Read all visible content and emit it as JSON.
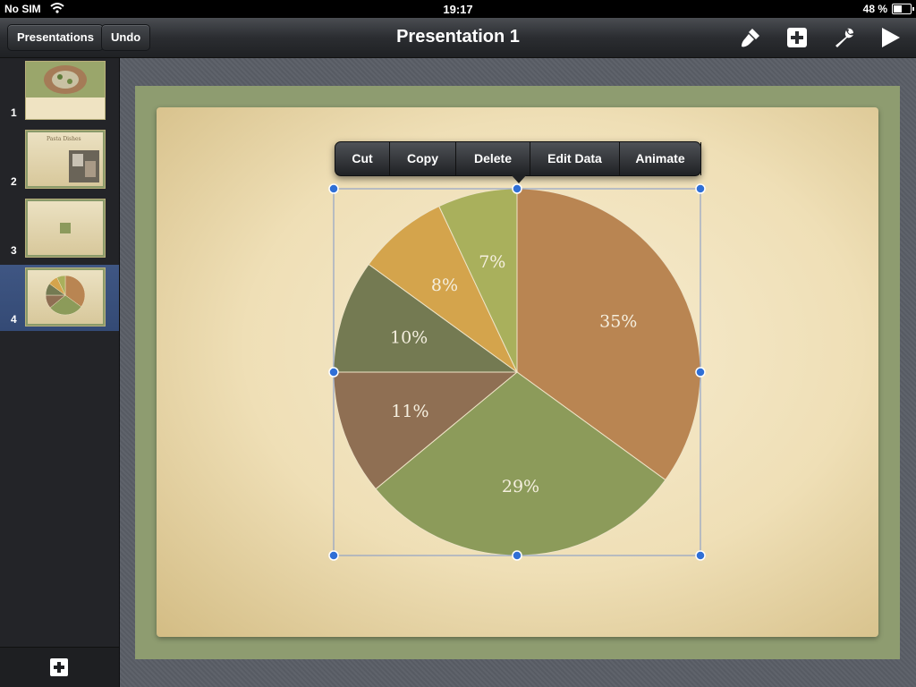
{
  "status": {
    "carrier": "No SIM",
    "time": "19:17",
    "battery": "48 %",
    "battery_level": 0.48
  },
  "toolbar": {
    "presentations_label": "Presentations",
    "undo_label": "Undo",
    "title": "Presentation 1",
    "icons": [
      "paintbrush-icon",
      "add-icon",
      "wrench-icon",
      "play-icon"
    ]
  },
  "sidebar": {
    "slides": [
      {
        "number": "1"
      },
      {
        "number": "2",
        "caption": "Pasta Dishes"
      },
      {
        "number": "3"
      },
      {
        "number": "4"
      }
    ],
    "selected": 4
  },
  "context_menu": {
    "items": [
      "Cut",
      "Copy",
      "Delete",
      "Edit Data",
      "Animate"
    ]
  },
  "chart_data": {
    "type": "pie",
    "slices": [
      {
        "label": "35%",
        "value": 35,
        "color": "#b98552"
      },
      {
        "label": "29%",
        "value": 29,
        "color": "#8c9b5a"
      },
      {
        "label": "11%",
        "value": 11,
        "color": "#8f6f53"
      },
      {
        "label": "10%",
        "value": 10,
        "color": "#747a52"
      },
      {
        "label": "8%",
        "value": 8,
        "color": "#d4a44c"
      },
      {
        "label": "7%",
        "value": 7,
        "color": "#a9b05c"
      }
    ]
  }
}
